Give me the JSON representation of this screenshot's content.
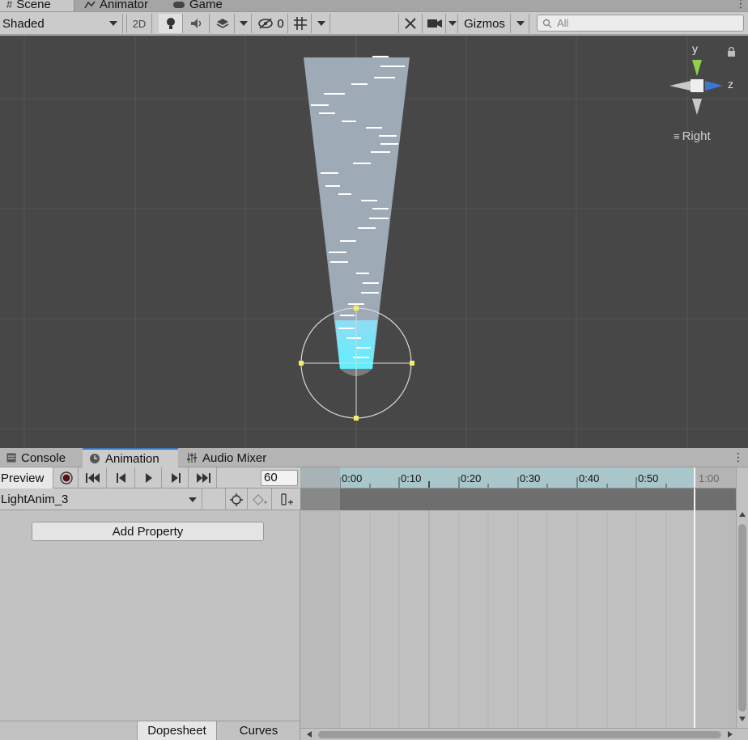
{
  "top_tabs": [
    {
      "label": "Scene",
      "icon": "grid-icon"
    },
    {
      "label": "Animator",
      "icon": "animator-icon"
    },
    {
      "label": "Game",
      "icon": "gamepad-icon"
    }
  ],
  "scene_toolbar": {
    "draw_mode": "Shaded",
    "mode_2d": "2D",
    "hidden_count": "0",
    "gizmos_label": "Gizmos",
    "search_placeholder": "All"
  },
  "orientation_gizmo": {
    "y_label": "y",
    "z_label": "z",
    "view_label": "Right"
  },
  "anim_tabs": [
    {
      "label": "Console",
      "icon": "console-icon"
    },
    {
      "label": "Animation",
      "icon": "clock-icon"
    },
    {
      "label": "Audio Mixer",
      "icon": "mixer-icon"
    }
  ],
  "anim_controls": {
    "preview_label": "Preview",
    "sample_rate": "60"
  },
  "clip": {
    "name": "LightAnim_3"
  },
  "add_property_label": "Add Property",
  "bottom_tabs": {
    "dopesheet": "Dopesheet",
    "curves": "Curves"
  },
  "timeline": {
    "ticks": [
      "0:00",
      "0:10",
      "0:20",
      "0:30",
      "0:40",
      "0:50",
      "1:00"
    ]
  },
  "colors": {
    "scene_bg": "#474747",
    "ruler_bg": "#a9c7cb",
    "accent": "#3a79bb",
    "light_cone": "#9eaab6",
    "light_glow": "#6fe3ff",
    "gizmo_y": "#8fd14f",
    "gizmo_z": "#3c77d6"
  }
}
